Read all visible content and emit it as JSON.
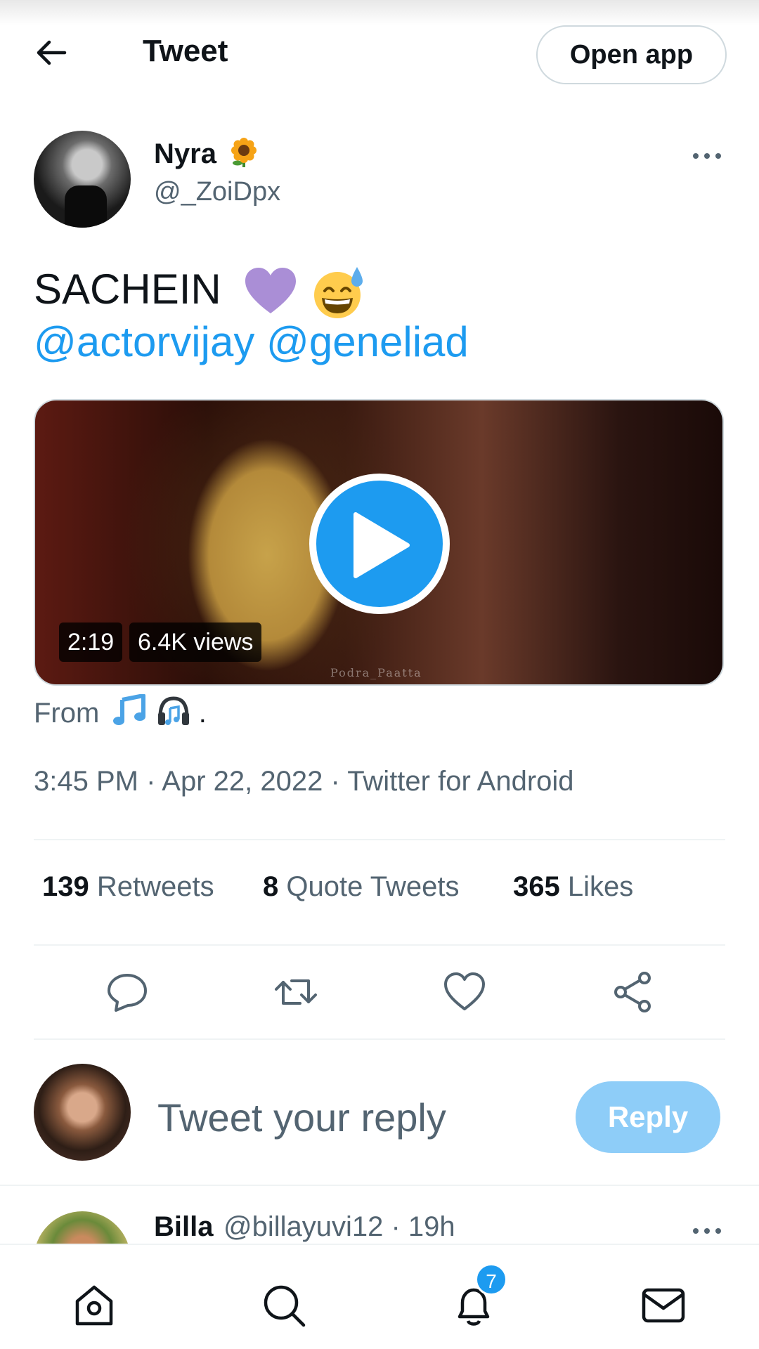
{
  "header": {
    "title": "Tweet",
    "open_app_label": "Open app"
  },
  "tweet": {
    "author_name": "Nyra",
    "author_handle": "@_ZoiDpx",
    "text": "SACHEIN",
    "mentions": [
      "@actorvijay",
      "@geneliad"
    ],
    "video": {
      "duration": "2:19",
      "views": "6.4K views",
      "watermark": "Podra_Paatta"
    },
    "from_label": "From",
    "from_suffix": ".",
    "timestamp": "3:45 PM · Apr 22, 2022 · Twitter for Android"
  },
  "stats": {
    "retweets_count": "139",
    "retweets_label": "Retweets",
    "quotes_count": "8",
    "quotes_label": "Quote Tweets",
    "likes_count": "365",
    "likes_label": "Likes"
  },
  "reply": {
    "placeholder": "Tweet your reply",
    "button_label": "Reply"
  },
  "next_reply": {
    "name": "Billa",
    "handle": "@billayuvi12 · 19h"
  },
  "bottom_nav": {
    "notification_count": "7",
    "items": [
      "home-icon",
      "search-icon",
      "notifications-icon",
      "messages-icon"
    ]
  },
  "colors": {
    "accent": "#1d9bf0",
    "reply_button": "#8ecdf8",
    "secondary_text": "#536471",
    "divider": "#eff3f4"
  }
}
